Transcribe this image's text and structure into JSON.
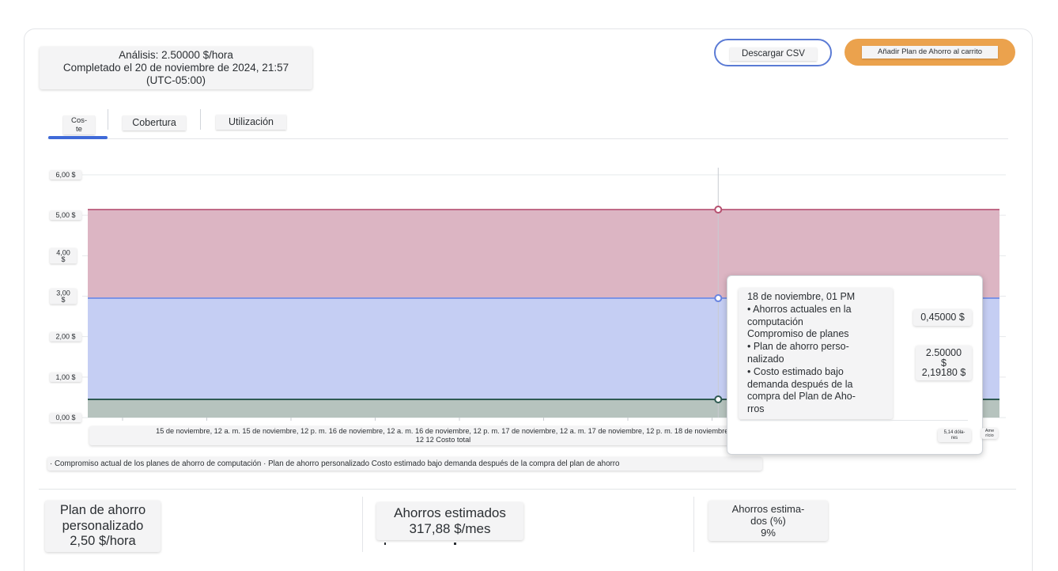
{
  "header": {
    "analysis_line1": "Análisis: 2.50000 $/hora",
    "analysis_line2": "Completado el 20 de noviembre de 2024, 21:57",
    "analysis_line3": "(UTC-05:00)",
    "download_csv_label": "Descargar CSV",
    "add_to_cart_label": "Añadir Plan de Ahorro al carrito"
  },
  "tabs": [
    {
      "label": "Cos-\nte",
      "active": true
    },
    {
      "label": "Cobertura",
      "active": false
    },
    {
      "label": "Utilización",
      "active": false
    }
  ],
  "chart_data": {
    "type": "area",
    "y_ticks": [
      "6,00 $",
      "5,00 $",
      "4,00\n$",
      "3,00\n$",
      "2,00 $",
      "1,00 $",
      "0,00 $"
    ],
    "ylim": [
      0,
      6
    ],
    "x_labels_line1": "15 de noviembre, 12 a. m. 15 de noviembre, 12 p. m. 16 de noviembre, 12 a. m. 16 de noviembre, 12 p. m. 17 de noviembre, 12 a. m. 17 de noviembre, 12 p. m. 18 de noviembre,",
    "x_labels_line2": "12 12 Costo total",
    "hover_fraction": 0.6915,
    "series": [
      {
        "name": "Compromiso actual de los planes de ahorro de computación",
        "value": 0.45,
        "color": "#4f8a7e"
      },
      {
        "name": "Plan de ahorro personalizado",
        "value": 2.95,
        "color": "#7b93e6"
      },
      {
        "name": "Costo estimado bajo demanda después de la compra del plan de ahorro",
        "value": 5.14,
        "color": "#c06a87"
      }
    ],
    "legend_text": "· Compromiso actual de los planes de ahorro de computación · Plan de ahorro personalizado Costo estimado bajo demanda después de la compra del plan de ahorro",
    "grid": true
  },
  "tooltip": {
    "lines": [
      "18 de noviembre, 01 PM",
      "• Ahorros actuales en la",
      "computación",
      "Compromiso de planes",
      "• Plan de ahorro perso-",
      "nalizado",
      "• Costo estimado bajo",
      "demanda después de la",
      "compra del Plan de Aho-",
      "rros"
    ],
    "value1": "0,45000 $",
    "value2_line1": "2.50000",
    "value2_line2": "$",
    "value2_line3": "2,19180 $",
    "value3": "5,14 dóla-\nres",
    "value4": "Ame\nrício"
  },
  "metrics": {
    "plan_line1": "Plan de ahorro",
    "plan_line2": "personalizado",
    "plan_line3": "2,50 $/hora",
    "savings_line1": "Ahorros estimados",
    "savings_line2": "317,88 $/mes",
    "savings_pct_line1": "Ahorros estima-",
    "savings_pct_line2": "dos (%)",
    "savings_pct_line3": "9%"
  }
}
